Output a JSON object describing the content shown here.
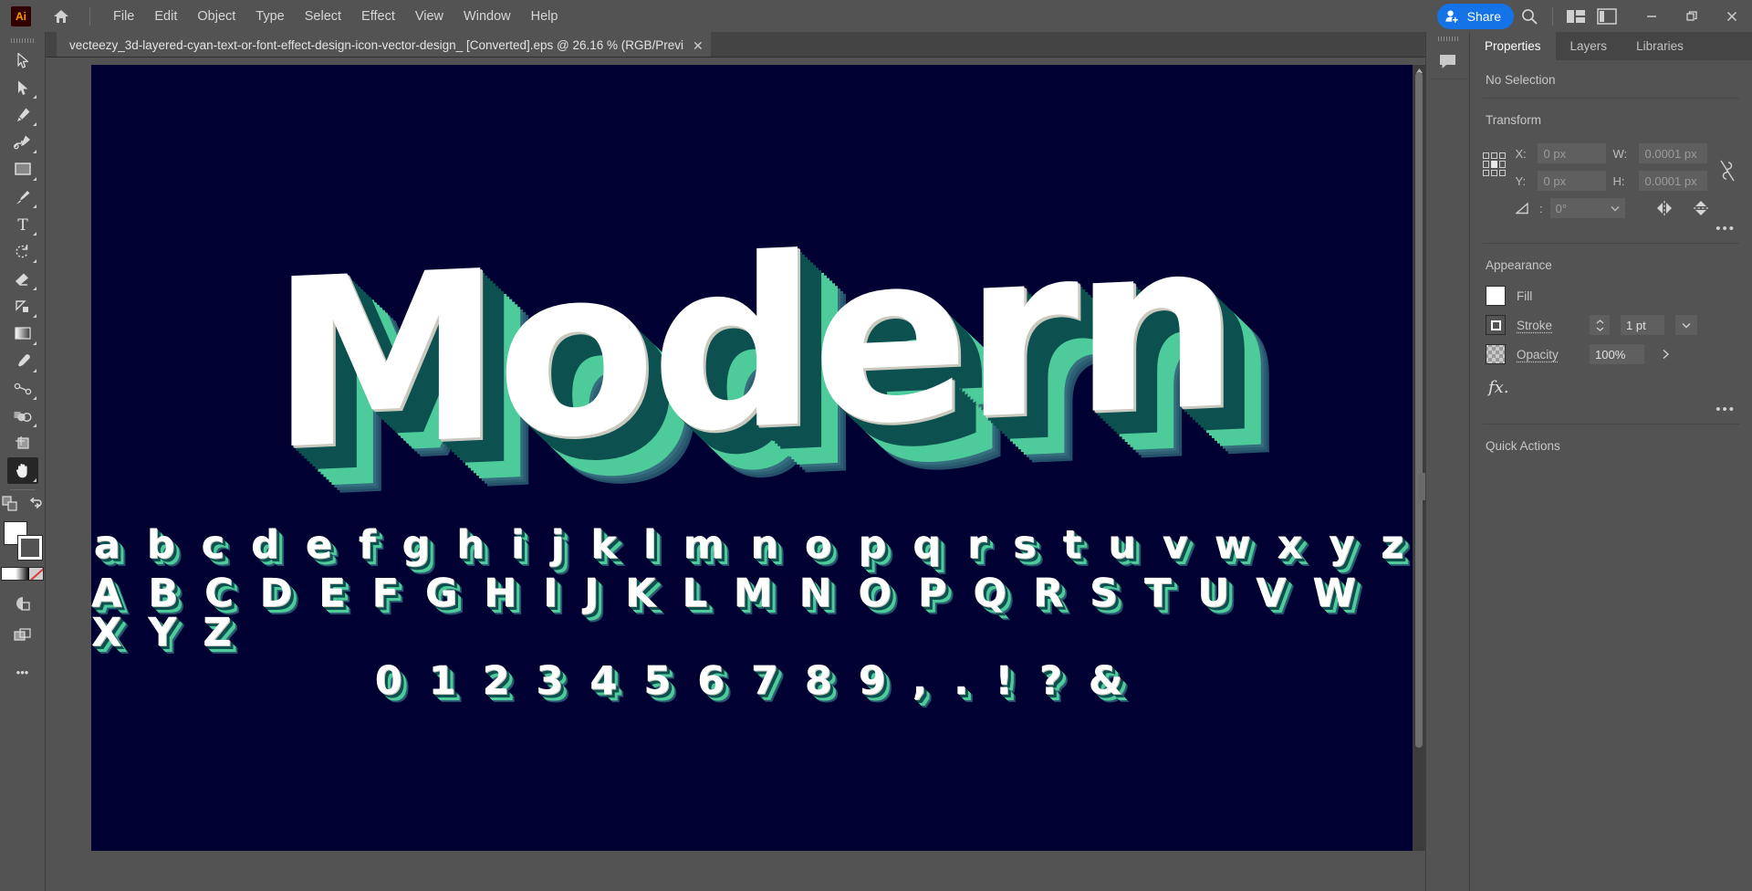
{
  "app": {
    "logo_text": "Ai",
    "home_icon": "home-icon"
  },
  "menubar": {
    "items": [
      "File",
      "Edit",
      "Object",
      "Type",
      "Select",
      "Effect",
      "View",
      "Window",
      "Help"
    ],
    "share_label": "Share",
    "icons": [
      "share-person-icon",
      "search-icon",
      "arrange-documents-icon",
      "panel-toggle-icon"
    ],
    "window_controls": {
      "minimize": "–",
      "restore": "❐",
      "close": "✕"
    }
  },
  "document": {
    "tab_title": "vecteezy_3d-layered-cyan-text-or-font-effect-design-icon-vector-design_ [Converted].eps @ 26.16 % (RGB/Previ",
    "close_glyph": "✕",
    "zoom_level": "26.16 %",
    "color_mode": "RGB/Preview"
  },
  "toolbar": {
    "tools": [
      {
        "name": "selection-tool",
        "label": "Selection"
      },
      {
        "name": "direct-selection-tool",
        "label": "Direct Selection"
      },
      {
        "name": "pen-tool",
        "label": "Pen"
      },
      {
        "name": "curvature-tool",
        "label": "Curvature"
      },
      {
        "name": "rectangle-tool",
        "label": "Rectangle"
      },
      {
        "name": "paintbrush-tool",
        "label": "Paintbrush"
      },
      {
        "name": "type-tool",
        "label": "Type"
      },
      {
        "name": "rotate-tool",
        "label": "Rotate"
      },
      {
        "name": "eraser-tool",
        "label": "Eraser"
      },
      {
        "name": "scale-tool",
        "label": "Scale"
      },
      {
        "name": "gradient-tool",
        "label": "Gradient"
      },
      {
        "name": "eyedropper-tool",
        "label": "Eyedropper"
      },
      {
        "name": "blend-tool",
        "label": "Blend"
      },
      {
        "name": "shape-builder-tool",
        "label": "Shape Builder"
      },
      {
        "name": "artboard-tool",
        "label": "Artboard"
      },
      {
        "name": "hand-tool",
        "label": "Hand"
      }
    ],
    "active_tool": "hand-tool",
    "swap-fill-stroke": "swap-fill-stroke-icon",
    "default-fill-stroke": "default-fill-stroke-icon",
    "fill_color": "#ffffff",
    "stroke_color": "#ffffff",
    "mini_swatches": [
      "color",
      "gradient",
      "none"
    ],
    "draw_mode": "draw-normal-icon",
    "screen_mode": "screen-mode-icon",
    "more_tools": "•••"
  },
  "panel": {
    "tabs": [
      {
        "label": "Properties",
        "active": true
      },
      {
        "label": "Layers",
        "active": false
      },
      {
        "label": "Libraries",
        "active": false
      }
    ],
    "selection_status": "No Selection",
    "transform": {
      "title": "Transform",
      "x_label": "X:",
      "x_value": "0 px",
      "y_label": "Y:",
      "y_value": "0 px",
      "w_label": "W:",
      "w_value": "0.0001 px",
      "h_label": "H:",
      "h_value": "0.0001 px",
      "angle_value": "0°",
      "link_icon": "unlink-proportions-icon",
      "flip_horizontal": "flip-horizontal-icon",
      "flip_vertical": "flip-vertical-icon",
      "more": "•••"
    },
    "appearance": {
      "title": "Appearance",
      "fill_label": "Fill",
      "fill_color": "#ffffff",
      "stroke_label": "Stroke",
      "stroke_weight": "1 pt",
      "opacity_label": "Opacity",
      "opacity_value": "100%",
      "fx_label": "fx.",
      "more": "•••"
    },
    "quick_actions": {
      "title": "Quick Actions"
    }
  },
  "rail": {
    "buttons": [
      {
        "name": "comments-icon"
      }
    ]
  },
  "artwork": {
    "word": "Modern",
    "lowercase": "a b c d e f g h i j k l m n o p q r s t u v w x y z",
    "uppercase": "A B C D E F G H I J K L M N O P Q R S T U V W X Y Z",
    "numbers": "0 1 2 3 4 5 6 7 8 9 , . ! ? &",
    "colors": {
      "background": "#000033",
      "face": "#ffffff",
      "edge_highlight": "#c9c9c0",
      "depth_dark": "#0d5050",
      "depth_mint": "#4ecb9a",
      "shadow": "#24506a"
    }
  }
}
